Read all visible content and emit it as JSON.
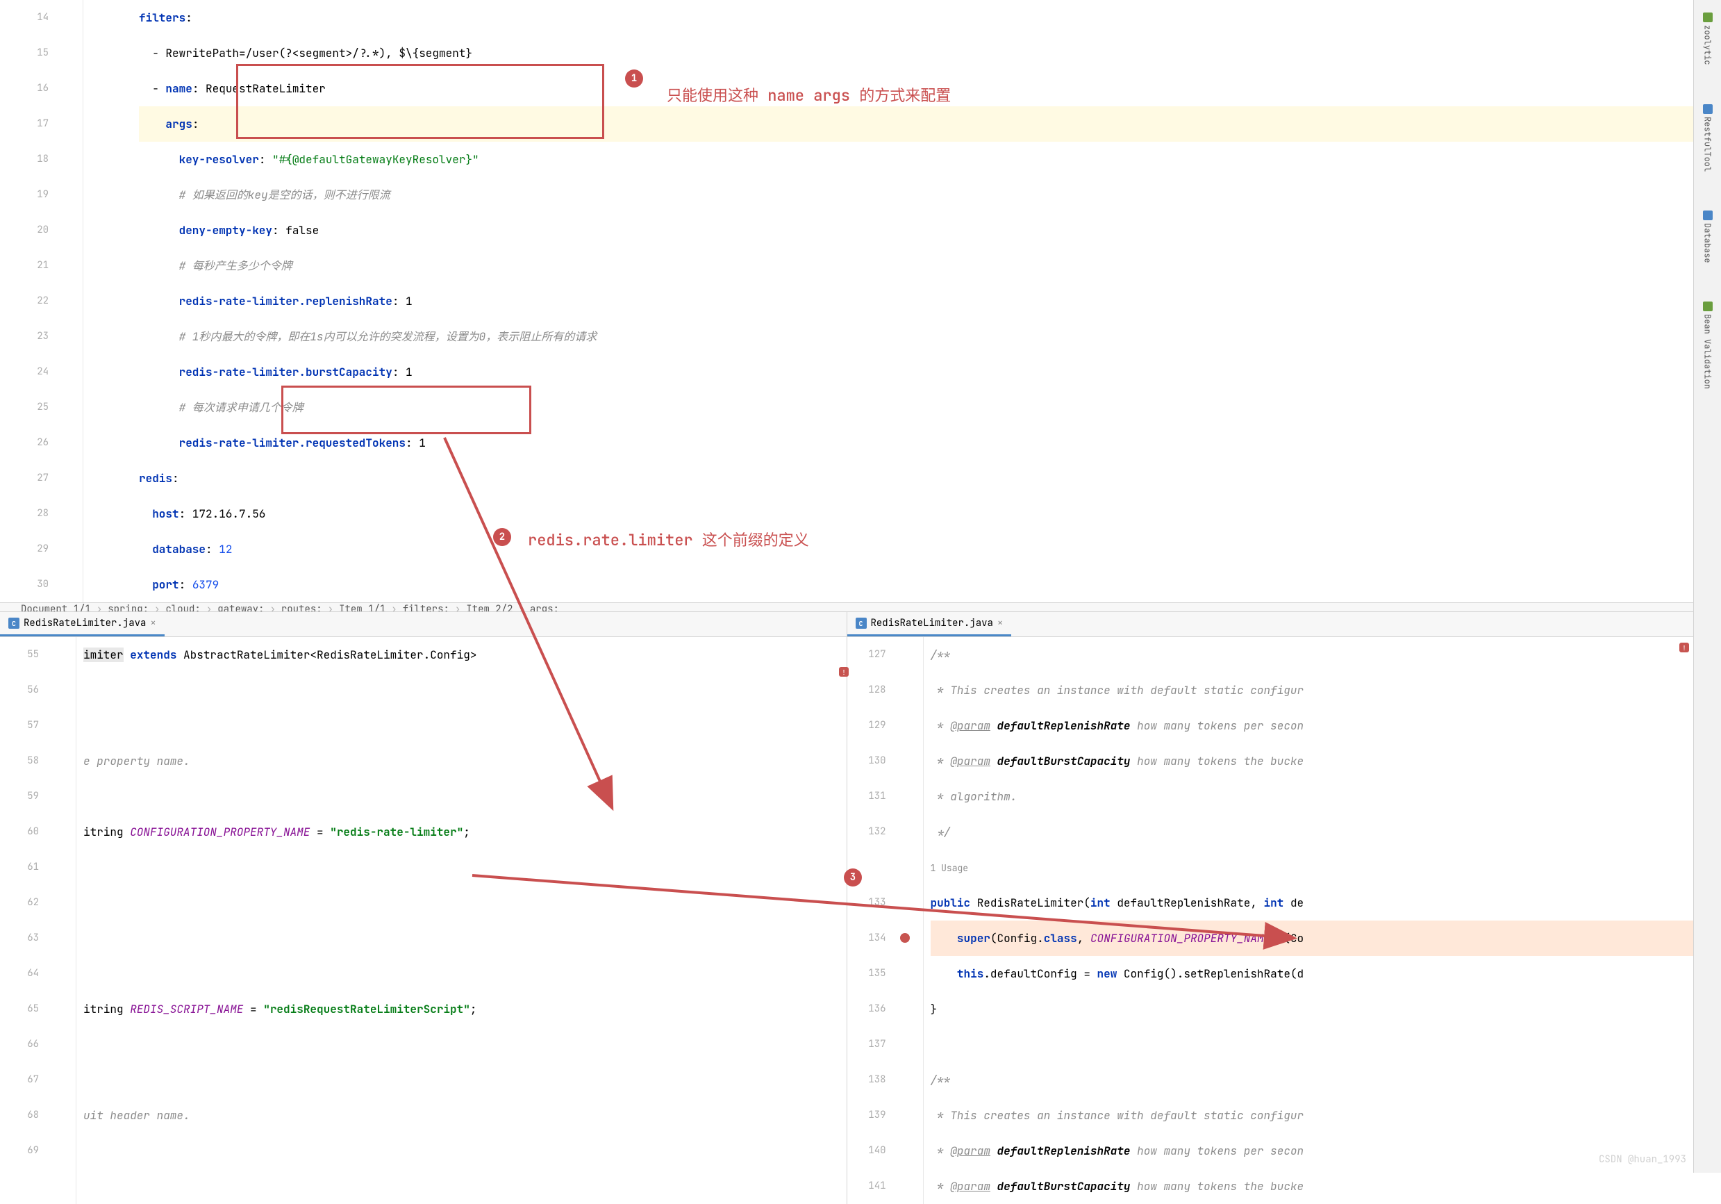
{
  "topEditor": {
    "lines": [
      {
        "num": "14",
        "html": [
          [
            "key",
            "filters"
          ],
          [
            "plain",
            ":"
          ]
        ]
      },
      {
        "num": "15",
        "html": [
          [
            "plain",
            "  - RewritePath=/user(?<segment>/?.*), $\\{segment}"
          ]
        ]
      },
      {
        "num": "16",
        "html": [
          [
            "plain",
            "  - "
          ],
          [
            "key",
            "name"
          ],
          [
            "plain",
            ": RequestRateLimiter"
          ]
        ]
      },
      {
        "num": "17",
        "highlight": true,
        "html": [
          [
            "plain",
            "    "
          ],
          [
            "key",
            "args"
          ],
          [
            "plain",
            ":"
          ]
        ]
      },
      {
        "num": "18",
        "html": [
          [
            "plain",
            "      "
          ],
          [
            "key",
            "key-resolver"
          ],
          [
            "plain",
            ": "
          ],
          [
            "str",
            "\"#{@defaultGatewayKeyResolver}\""
          ]
        ]
      },
      {
        "num": "19",
        "html": [
          [
            "plain",
            "      "
          ],
          [
            "comment",
            "# 如果返回的key是空的话，则不进行限流"
          ]
        ]
      },
      {
        "num": "20",
        "html": [
          [
            "plain",
            "      "
          ],
          [
            "key",
            "deny-empty-key"
          ],
          [
            "plain",
            ": false"
          ]
        ]
      },
      {
        "num": "21",
        "html": [
          [
            "plain",
            "      "
          ],
          [
            "comment",
            "# 每秒产生多少个令牌"
          ]
        ]
      },
      {
        "num": "22",
        "html": [
          [
            "plain",
            "      "
          ],
          [
            "key",
            "redis-rate-limiter.replenishRate"
          ],
          [
            "plain",
            ": 1"
          ]
        ]
      },
      {
        "num": "23",
        "html": [
          [
            "plain",
            "      "
          ],
          [
            "comment",
            "# 1秒内最大的令牌，即在1s内可以允许的突发流程，设置为0，表示阻止所有的请求"
          ]
        ]
      },
      {
        "num": "24",
        "html": [
          [
            "plain",
            "      "
          ],
          [
            "key",
            "redis-rate-limiter.burstCapacity"
          ],
          [
            "plain",
            ": 1"
          ]
        ]
      },
      {
        "num": "25",
        "html": [
          [
            "plain",
            "      "
          ],
          [
            "comment",
            "# 每次请求申请几个令牌"
          ]
        ]
      },
      {
        "num": "26",
        "html": [
          [
            "plain",
            "      "
          ],
          [
            "key",
            "redis-rate-limiter.requestedTokens"
          ],
          [
            "plain",
            ": 1"
          ]
        ]
      },
      {
        "num": "27",
        "html": [
          [
            "key",
            "redis"
          ],
          [
            "plain",
            ":"
          ]
        ]
      },
      {
        "num": "28",
        "html": [
          [
            "plain",
            "  "
          ],
          [
            "key",
            "host"
          ],
          [
            "plain",
            ": 172.16.7.56"
          ]
        ]
      },
      {
        "num": "29",
        "html": [
          [
            "plain",
            "  "
          ],
          [
            "key",
            "database"
          ],
          [
            "plain",
            ": "
          ],
          [
            "num",
            "12"
          ]
        ]
      },
      {
        "num": "30",
        "html": [
          [
            "plain",
            "  "
          ],
          [
            "key",
            "port"
          ],
          [
            "plain",
            ": "
          ],
          [
            "num",
            "6379"
          ]
        ]
      }
    ]
  },
  "breadcrumb": [
    "Document 1/1",
    "spring:",
    "cloud:",
    "gateway:",
    "routes:",
    "Item 1/1",
    "filters:",
    "Item 2/2",
    "args:"
  ],
  "leftJava": {
    "tab": "RedisRateLimiter.java",
    "lines": [
      {
        "num": "55",
        "text": "imiter extends AbstractRateLimiter<RedisRateLimiter.Config>"
      },
      {
        "num": "56",
        "text": ""
      },
      {
        "num": "57",
        "text": ""
      },
      {
        "num": "58",
        "text": "e property name."
      },
      {
        "num": "59",
        "text": ""
      },
      {
        "num": "60",
        "text": "itring CONFIGURATION_PROPERTY_NAME = \"redis-rate-limiter\";"
      },
      {
        "num": "61",
        "text": ""
      },
      {
        "num": "62",
        "text": ""
      },
      {
        "num": "63",
        "text": ""
      },
      {
        "num": "64",
        "text": ""
      },
      {
        "num": "65",
        "text": "itring REDIS_SCRIPT_NAME = \"redisRequestRateLimiterScript\";"
      },
      {
        "num": "66",
        "text": ""
      },
      {
        "num": "67",
        "text": ""
      },
      {
        "num": "68",
        "text": "uit header name."
      },
      {
        "num": "69",
        "text": ""
      }
    ]
  },
  "rightJava": {
    "tab": "RedisRateLimiter.java",
    "lines": [
      {
        "num": "127",
        "text": "/**"
      },
      {
        "num": "128",
        "text": " * This creates an instance with default static configur"
      },
      {
        "num": "129",
        "text": " * @param defaultReplenishRate how many tokens per secon"
      },
      {
        "num": "130",
        "text": " * @param defaultBurstCapacity how many tokens the bucke"
      },
      {
        "num": "131",
        "text": " * algorithm."
      },
      {
        "num": "132",
        "text": " */"
      },
      {
        "num": "",
        "usage": "1 Usage"
      },
      {
        "num": "133",
        "text": "public RedisRateLimiter(int defaultReplenishRate, int de"
      },
      {
        "num": "134",
        "text": "    super(Config.class, CONFIGURATION_PROPERTY_NAME, (Co",
        "hl": true,
        "bp": true
      },
      {
        "num": "135",
        "text": "    this.defaultConfig = new Config().setReplenishRate(d"
      },
      {
        "num": "136",
        "text": "}"
      },
      {
        "num": "137",
        "text": ""
      },
      {
        "num": "138",
        "text": "/**"
      },
      {
        "num": "139",
        "text": " * This creates an instance with default static configur"
      },
      {
        "num": "140",
        "text": " * @param defaultReplenishRate how many tokens per secon"
      },
      {
        "num": "141",
        "text": " * @param defaultBurstCapacity how many tokens the bucke"
      }
    ]
  },
  "tools": [
    "zoolytic",
    "RestfulTool",
    "Database",
    "Bean Validation"
  ],
  "annotations": {
    "note1": "只能使用这种 name args 的方式来配置",
    "note2": "redis.rate.limiter 这个前缀的定义",
    "badge1": "1",
    "badge2": "2",
    "badge3": "3"
  },
  "watermark": "CSDN @huan_1993"
}
